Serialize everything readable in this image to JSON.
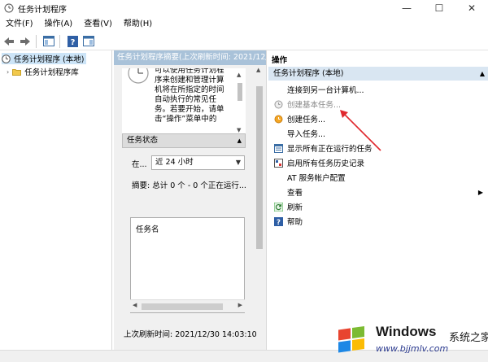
{
  "window": {
    "title": "任务计划程序",
    "minimize_glyph": "—",
    "maximize_glyph": "☐",
    "close_glyph": "✕"
  },
  "menu": {
    "items": [
      "文件(F)",
      "操作(A)",
      "查看(V)",
      "帮助(H)"
    ]
  },
  "toolbar": {
    "icons": [
      "back-icon",
      "forward-icon",
      "show-pane-icon",
      "help-icon",
      "properties-icon"
    ]
  },
  "tree": {
    "root_label": "任务计划程序 (本地)",
    "child_label": "任务计划程序库"
  },
  "center": {
    "header": "任务计划程序摘要(上次刷新时间: 2021/12/",
    "summary_lines": [
      "可以使用任务计划程",
      "序来创建和管理计算",
      "机将在所指定的时间",
      "自动执行的常见任",
      "务。若要开始，请单",
      "击“操作”菜单中的"
    ],
    "status_header": "任务状态",
    "filter_label": "在...",
    "filter_value": "近 24 小时",
    "summary_label": "摘要: 总计 0 个 - 0 个正在运行...",
    "task_name_header": "任务名",
    "last_refresh": "上次刷新时间: 2021/12/30 14:03:10"
  },
  "actions": {
    "title": "操作",
    "section_label": "任务计划程序 (本地)",
    "items": [
      {
        "label": "连接到另一台计算机...",
        "icon": "none",
        "disabled": false
      },
      {
        "label": "创建基本任务...",
        "icon": "create-basic-task-icon",
        "disabled": true
      },
      {
        "label": "创建任务...",
        "icon": "create-task-icon",
        "disabled": false
      },
      {
        "label": "导入任务...",
        "icon": "none",
        "disabled": false
      },
      {
        "label": "显示所有正在运行的任务",
        "icon": "running-tasks-icon",
        "disabled": false
      },
      {
        "label": "启用所有任务历史记录",
        "icon": "history-icon",
        "disabled": false
      },
      {
        "label": "AT 服务帐户配置",
        "icon": "none",
        "disabled": false
      },
      {
        "label": "查看",
        "icon": "none",
        "disabled": false
      },
      {
        "label": "刷新",
        "icon": "refresh-icon",
        "disabled": false
      },
      {
        "label": "帮助",
        "icon": "help-icon",
        "disabled": false
      }
    ]
  },
  "watermark": {
    "brand": "Windows",
    "site_name": "系统之家",
    "url": "www.bjjmlv.com"
  },
  "colors": {
    "center_header": "#a9c2d9",
    "action_section": "#d9e6f2",
    "arrow": "#e0282e",
    "selection": "#cce4f7"
  }
}
